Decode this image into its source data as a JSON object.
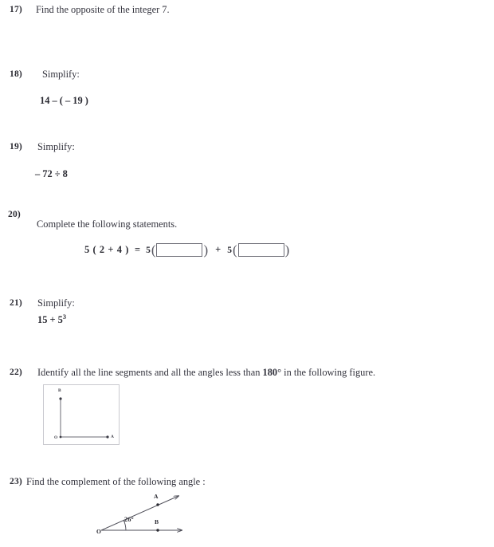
{
  "worksheet": {
    "problems": [
      {
        "number": "17)",
        "text": "Find the opposite of the integer 7."
      },
      {
        "number": "18)",
        "text": "Simplify:",
        "expression": "14  –  ( – 19 )"
      },
      {
        "number": "19)",
        "text": "Simplify:",
        "expression": "– 72  ÷  8"
      },
      {
        "number": "20)",
        "text": "Complete the following statements.",
        "equation": {
          "left": "5 ( 2 + 4 )",
          "equals": "=",
          "coefficient_1": "5",
          "box_1_value": "",
          "operator": "+",
          "coefficient_2": "5",
          "box_2_value": "",
          "open_paren": "(",
          "close_paren": ")"
        }
      },
      {
        "number": "21)",
        "text": "Simplify:",
        "expression_base": "15  +  5",
        "expression_exponent": "3"
      },
      {
        "number": "22)",
        "text_before": "Identify all the line segments and all the angles less than ",
        "text_bold": "180°",
        "text_after": " in the following figure.",
        "figure": {
          "vertex_label": "O",
          "horizontal_point_label": "A",
          "vertical_point_label": "B"
        }
      },
      {
        "number": "23)",
        "text": "Find the complement of the following angle :",
        "figure": {
          "vertex_label": "O",
          "ray_label_upper": "A",
          "ray_label_lower": "B",
          "angle_measure": "26°"
        }
      }
    ]
  },
  "colors": {
    "text": "#2b2b33",
    "body_text": "#33333d",
    "box_border": "#6f6f78",
    "figure_border": "#c9c9cf",
    "line": "#5a5a64",
    "page_background": "#ffffff"
  }
}
